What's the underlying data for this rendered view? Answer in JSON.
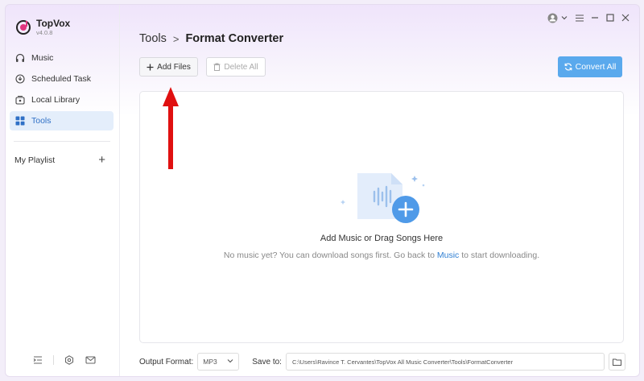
{
  "app": {
    "name": "TopVox",
    "version": "v4.0.8"
  },
  "sidebar": {
    "items": [
      {
        "label": "Music",
        "icon": "headphones-icon"
      },
      {
        "label": "Scheduled Task",
        "icon": "clock-download-icon"
      },
      {
        "label": "Local Library",
        "icon": "library-icon"
      },
      {
        "label": "Tools",
        "icon": "grid-icon",
        "active": true
      }
    ],
    "playlist_label": "My Playlist",
    "playlist_add": "+"
  },
  "breadcrumb": {
    "parent": "Tools",
    "separator": ">",
    "current": "Format Converter"
  },
  "toolbar": {
    "add_files": "Add Files",
    "delete_all": "Delete All",
    "convert_all": "Convert All"
  },
  "dropzone": {
    "title": "Add Music or Drag Songs Here",
    "sub_before": "No music yet? You can download songs first. Go back to ",
    "sub_link": "Music",
    "sub_after": " to start downloading."
  },
  "bottom": {
    "output_format_label": "Output Format:",
    "output_format_value": "MP3",
    "save_to_label": "Save to:",
    "save_path": "C:\\Users\\Ravince T. Cervantes\\TopVox All Music Converter\\Tools\\FormatConverter"
  },
  "colors": {
    "accent": "#5aa9ed",
    "active_bg": "#e4eefb",
    "annotation_arrow": "#e01010"
  }
}
